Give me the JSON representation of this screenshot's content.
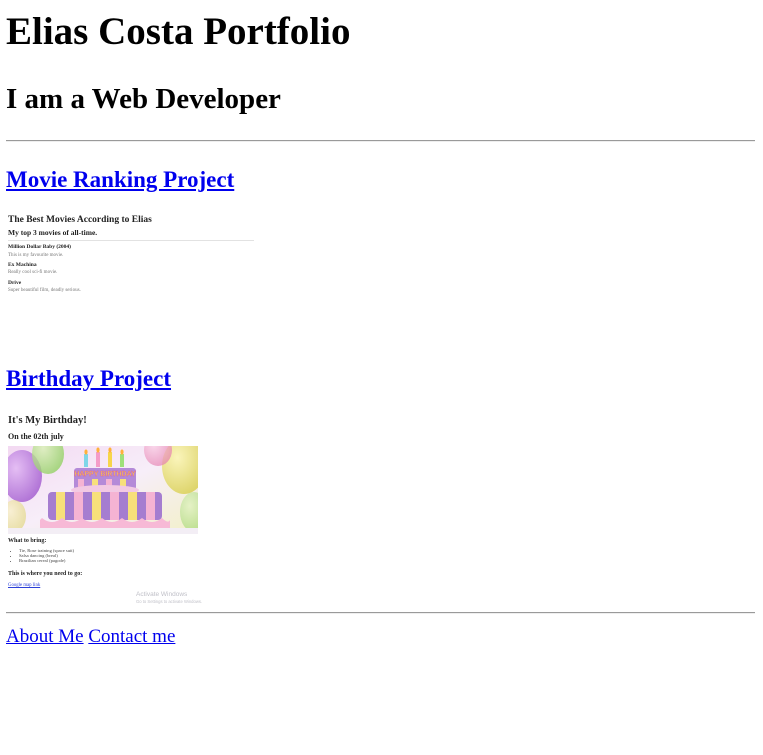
{
  "header": {
    "title": "Elias Costa Portfolio",
    "subtitle": "I am a Web Developer"
  },
  "projects": [
    {
      "heading": "Movie Ranking Project",
      "thumbnail": {
        "title": "The Best Movies According to Elias",
        "subtitle": "My top 3 movies of all-time.",
        "items": [
          {
            "name": "Million Dollar Baby (2004)",
            "description": "This is my favourite movie."
          },
          {
            "name": "Ex Machina",
            "description": "Really cool sci-fi movie."
          },
          {
            "name": "Drive",
            "description": "Super beautiful film, deadly serious."
          }
        ]
      }
    },
    {
      "heading": "Birthday Project",
      "thumbnail": {
        "title": "It's My Birthday!",
        "date": "On the 02th july",
        "cake_banner": "HAPPY BIRTHDAY",
        "bring_heading": "What to bring:",
        "bring_items": [
          "Tie, Rose training (space suit)",
          "Salsa dancing (breal)",
          "Brazilian cereal (pagode)"
        ],
        "where_heading": "This is where you need to go:",
        "map_link": "Google map link",
        "watermark_line1": "Activate Windows",
        "watermark_line2": "Go to Settings to activate Windows."
      }
    }
  ],
  "footer": {
    "links": [
      "About Me",
      "Contact me"
    ]
  },
  "colors": {
    "link": "#0000ee",
    "text": "#000000",
    "background": "#ffffff"
  }
}
